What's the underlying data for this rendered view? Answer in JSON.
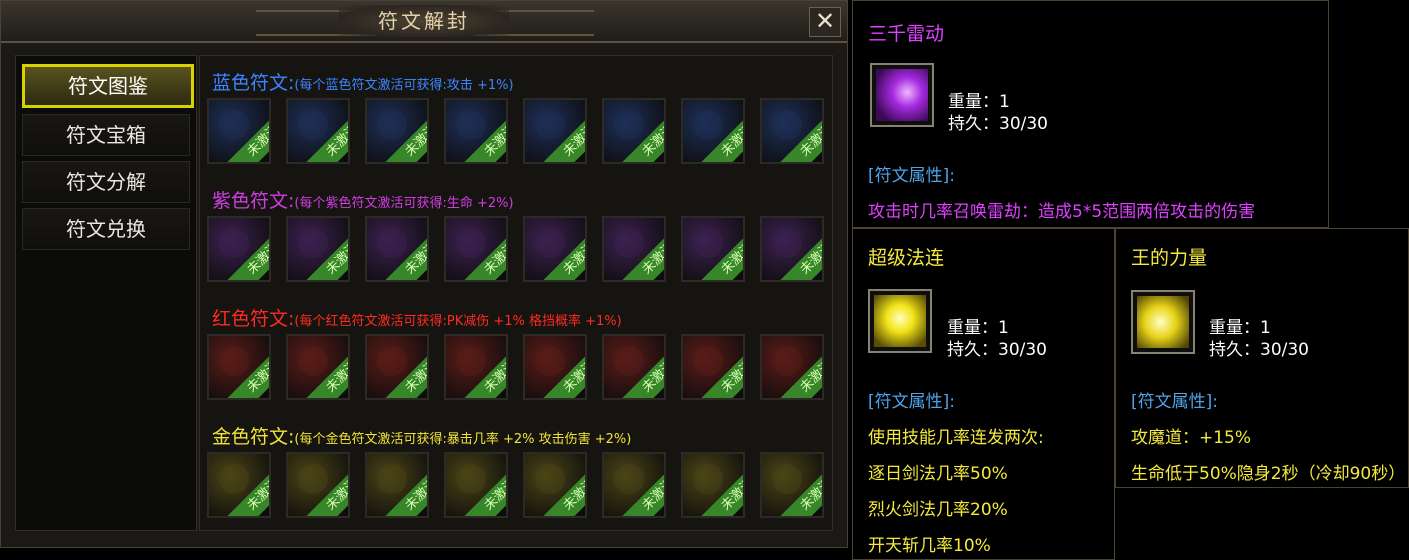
{
  "window": {
    "title": "符文解封",
    "close_label": "✕"
  },
  "sidebar": {
    "items": [
      {
        "label": "符文图鉴"
      },
      {
        "label": "符文宝箱"
      },
      {
        "label": "符文分解"
      },
      {
        "label": "符文兑换"
      }
    ]
  },
  "sections": [
    {
      "title": "蓝色符文:",
      "bonus": "(每个蓝色符文激活可获得:攻击 +1%)",
      "color": "#3a86ff"
    },
    {
      "title": "紫色符文:",
      "bonus": "(每个紫色符文激活可获得:生命 +2%)",
      "color": "#d13de3"
    },
    {
      "title": "红色符文:",
      "bonus": "(每个红色符文激活可获得:PK减伤 +1%    格挡概率 +1%)",
      "color": "#ff2a22"
    },
    {
      "title": "金色符文:",
      "bonus": "(每个金色符文激活可获得:暴击几率 +2%    攻击伤害 +2%)",
      "color": "#f0e33a"
    }
  ],
  "slot_label": "未激活",
  "slot_colors": [
    "#1e2f57",
    "#3c2150",
    "#5a1c18",
    "#4b4416"
  ],
  "tooltips": {
    "t1": {
      "name": "三千雷动",
      "name_color": "#e040ff",
      "weight": "重量：1",
      "durability": "持久：30/30",
      "attr_header": "[符文属性]:",
      "lines": [
        "攻击时几率召唤雷劫：造成5*5范围两倍攻击的伤害"
      ],
      "line_color": "#e040ff"
    },
    "t2": {
      "name": "超级法连",
      "name_color": "#f5ea3b",
      "weight": "重量：1",
      "durability": "持久：30/30",
      "attr_header": "[符文属性]:",
      "lines": [
        "使用技能几率连发两次:",
        "逐日剑法几率50%",
        "烈火剑法几率20%",
        "开天斩几率10%"
      ],
      "line_color": "#f5ea3b"
    },
    "t3": {
      "name": "王的力量",
      "name_color": "#f5ea3b",
      "weight": "重量：1",
      "durability": "持久：30/30",
      "attr_header": "[符文属性]:",
      "lines": [
        "攻魔道：+15%",
        "生命低于50%隐身2秒（冷却90秒）"
      ],
      "line_color": "#f5ea3b"
    }
  }
}
